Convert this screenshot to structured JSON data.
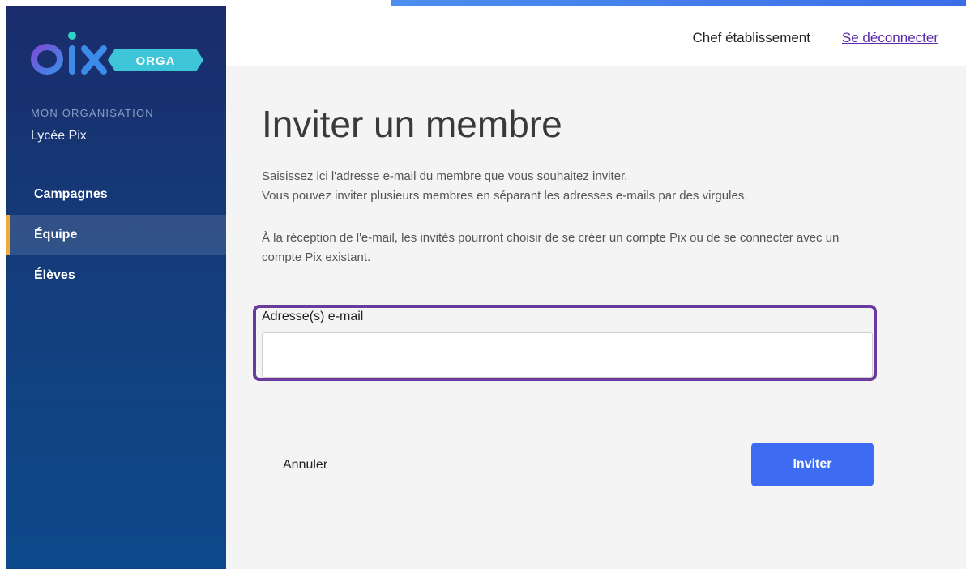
{
  "brand": {
    "logo_text": "pix",
    "logo_badge": "ORGA",
    "colors": {
      "sidebar_top": "#1a2c6b",
      "sidebar_bottom": "#0d4a8c",
      "logo_blue": "#3d8be8",
      "badge_teal": "#3ec6d8",
      "active_marker": "#f2a93b",
      "primary_button": "#3d6cf2",
      "highlight_border": "#6b3a9e"
    }
  },
  "sidebar": {
    "org_caption": "MON ORGANISATION",
    "org_name": "Lycée Pix",
    "items": [
      {
        "label": "Campagnes",
        "active": false
      },
      {
        "label": "Équipe",
        "active": true
      },
      {
        "label": "Élèves",
        "active": false
      }
    ]
  },
  "header": {
    "user_name": "Chef établissement",
    "logout_label": "Se déconnecter"
  },
  "main": {
    "title": "Inviter un membre",
    "description_line_1": "Saisissez ici l'adresse e-mail du membre que vous souhaitez inviter.",
    "description_line_2": "Vous pouvez inviter plusieurs membres en séparant les adresses e-mails par des virgules.",
    "description_paragraph_2": "À la réception de l'e-mail, les invités pourront choisir de se créer un compte Pix ou de se connecter avec un compte Pix existant.",
    "email_field": {
      "label": "Adresse(s) e-mail",
      "value": "",
      "placeholder": ""
    },
    "cancel_label": "Annuler",
    "invite_label": "Inviter"
  }
}
